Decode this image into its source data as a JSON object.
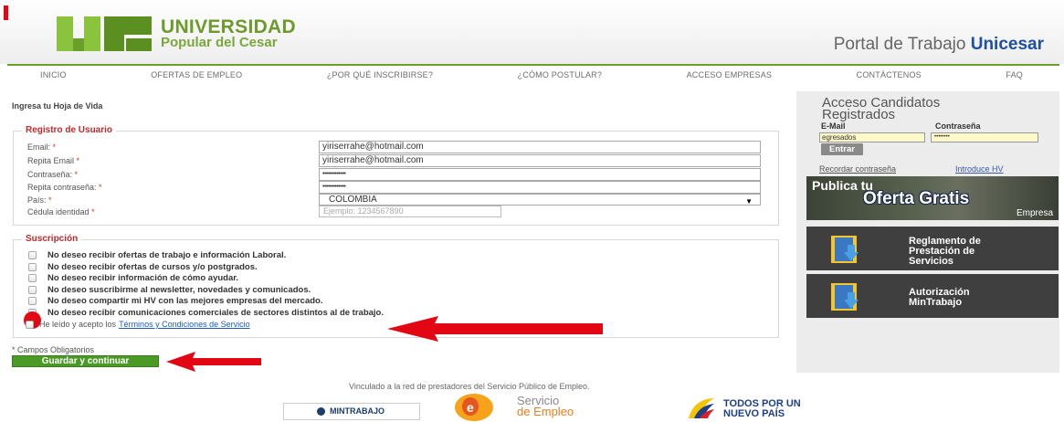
{
  "header": {
    "university_line1": "UNIVERSIDAD",
    "university_line2": "Popular del Cesar",
    "portal_prefix": "Portal de Trabajo ",
    "portal_brand": "Unicesar"
  },
  "nav": {
    "items": [
      "INICIO",
      "OFERTAS DE EMPLEO",
      "¿POR QUÉ INSCRIBIRSE?",
      "¿CÓMO POSTULAR?",
      "ACCESO EMPRESAS",
      "CONTÁCTENOS",
      "FAQ"
    ]
  },
  "main": {
    "heading": "Ingresa tu Hoja de Vida",
    "registro": {
      "legend": "Registro de Usuario",
      "email_label": "Email: ",
      "email_value": "yiriserrahe@hotmail.com",
      "repeat_email_label": "Repita Email ",
      "repeat_email_value": "yiriserrahe@hotmail.com",
      "password_label": "Contraseña: ",
      "password_value": "•••••••••••••",
      "repeat_password_label": "Repita contraseña: ",
      "repeat_password_value": "•••••••••••••",
      "country_label": "País: ",
      "country_value": "COLOMBIA",
      "cedula_label": "Cédula identidad ",
      "cedula_placeholder": "Ejemplo: 1234567890",
      "required_mark": "*"
    },
    "suscripcion": {
      "legend": "Suscripción",
      "options": [
        "No deseo recibir ofertas de trabajo e información Laboral.",
        "No deseo recibir ofertas de cursos y/o postgrados.",
        "No deseo recibir información de cómo ayudar.",
        "No deseo suscribirme al newsletter, novedades y comunicados.",
        "No deseo compartir mi HV con las mejores empresas del mercado.",
        "No deseo recibir comunicaciones comerciales de sectores distintos al de trabajo."
      ],
      "terms_prefix": "He leído y acepto los",
      "terms_link": "Términos y Condiciones de Servicio"
    },
    "required_note": "* Campos Obligatorios",
    "submit_label": "Guardar y continuar"
  },
  "sidebar": {
    "title_line1": "Acceso Candidatos",
    "title_line2": "Registrados",
    "email_label": "E-Mail",
    "password_label": "Contraseña",
    "email_value": "egresados",
    "password_value": "••••••••",
    "login_button": "Entrar",
    "forgot_link": "Recordar contraseña",
    "introduce_link": "Introduce HV",
    "banner_oferta": {
      "line1": "Publica tu",
      "line2": "Oferta Gratis",
      "line3": "Empresa"
    },
    "banner_reglamento": [
      "Reglamento de",
      "Prestación de",
      "Servicios"
    ],
    "banner_autorizacion": [
      "Autorización",
      "MinTrabajo"
    ]
  },
  "footer": {
    "vinculado": "Vinculado a la red de prestadores del Servicio Público de Empleo.",
    "mintrabajo": "MINTRABAJO",
    "servicio_line1": "Servicio",
    "servicio_line2": "de Empleo",
    "todos_line1": "TODOS POR UN",
    "todos_line2": "NUEVO PAÍS"
  },
  "colors": {
    "brand_green": "#6aa02a",
    "brand_blue": "#1f4fa0",
    "legend_red": "#c0292b",
    "annotation_red": "#e30613",
    "button_green": "#4c9a26"
  }
}
